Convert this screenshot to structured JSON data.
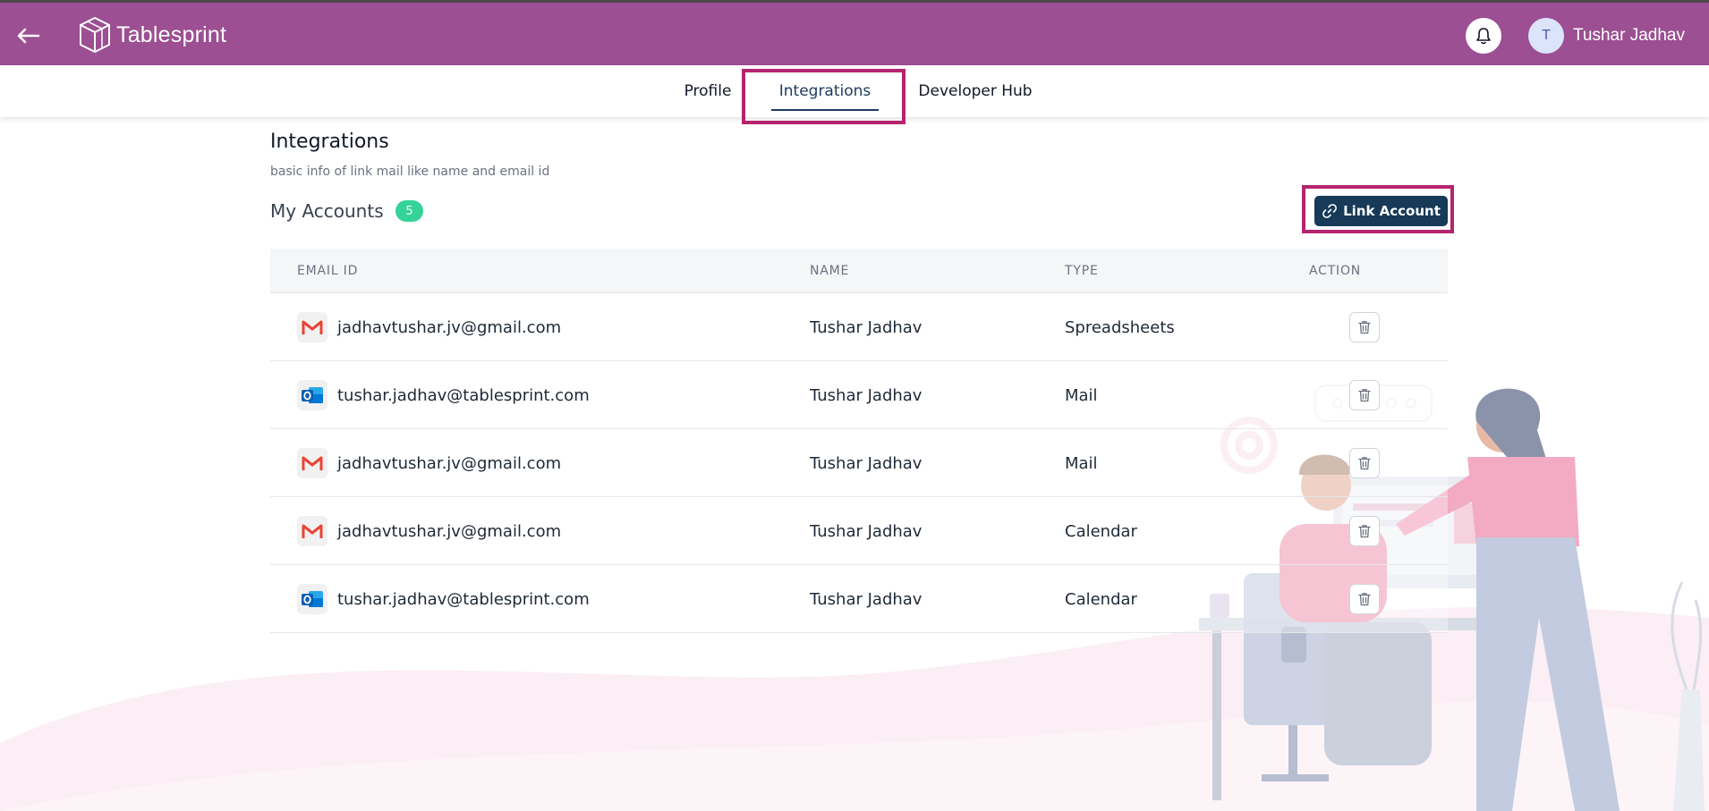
{
  "header": {
    "logo_text": "Tablesprint",
    "user_initial": "T",
    "user_name": "Tushar Jadhav",
    "bg_color": "#9c4f92"
  },
  "tabs": [
    {
      "label": "Profile",
      "active": false
    },
    {
      "label": "Integrations",
      "active": true
    },
    {
      "label": "Developer Hub",
      "active": false
    }
  ],
  "page": {
    "title": "Integrations",
    "subtitle": "basic info of link mail like name and email id",
    "accounts_title": "My Accounts",
    "accounts_count": "5",
    "link_button_label": "Link Account"
  },
  "table": {
    "headers": [
      "EMAIL ID",
      "NAME",
      "TYPE",
      "ACTION"
    ],
    "rows": [
      {
        "provider": "gmail-icon",
        "email": "jadhavtushar.jv@gmail.com",
        "name": "Tushar Jadhav",
        "type": "Spreadsheets"
      },
      {
        "provider": "outlook-icon",
        "email": "tushar.jadhav@tablesprint.com",
        "name": "Tushar Jadhav",
        "type": "Mail"
      },
      {
        "provider": "gmail-icon",
        "email": "jadhavtushar.jv@gmail.com",
        "name": "Tushar Jadhav",
        "type": "Mail"
      },
      {
        "provider": "gmail-icon",
        "email": "jadhavtushar.jv@gmail.com",
        "name": "Tushar Jadhav",
        "type": "Calendar"
      },
      {
        "provider": "outlook-icon",
        "email": "tushar.jadhav@tablesprint.com",
        "name": "Tushar Jadhav",
        "type": "Calendar"
      }
    ]
  },
  "colors": {
    "accent": "#163a57",
    "highlight": "#b5246e",
    "badge": "#34d399"
  }
}
